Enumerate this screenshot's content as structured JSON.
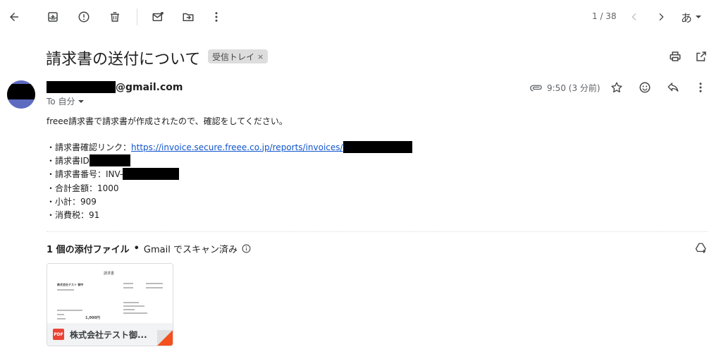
{
  "toolbar": {
    "pager": "1 / 38",
    "language_label": "あ"
  },
  "message": {
    "subject": "請求書の送付について",
    "label": "受信トレイ",
    "label_remove": "×",
    "sender_suffix": "@gmail.com",
    "to_label": "To 自分",
    "time": "9:50 (3 分前)"
  },
  "body": {
    "line1": "freee請求書で請求書が作成されたので、確認をしてください。",
    "link_prefix": "・請求書確認リンク：",
    "link_text": "https://invoice.secure.freee.co.jp/reports/invoices/",
    "id_label": "・請求書ID",
    "number_label": "・請求書番号：INV-",
    "total": "・合計金額：1000",
    "subtotal": "・小計：909",
    "tax": "・消費税：91"
  },
  "attachments": {
    "count_label": "1 個の添付ファイル",
    "separator": "•",
    "scan_label": "Gmail でスキャン済み",
    "file_type": "PDF",
    "file_name": "株式会社テスト御...",
    "preview": {
      "title": "請求書",
      "company": "株式会社テスト 御中",
      "amount": "1,000円"
    }
  }
}
